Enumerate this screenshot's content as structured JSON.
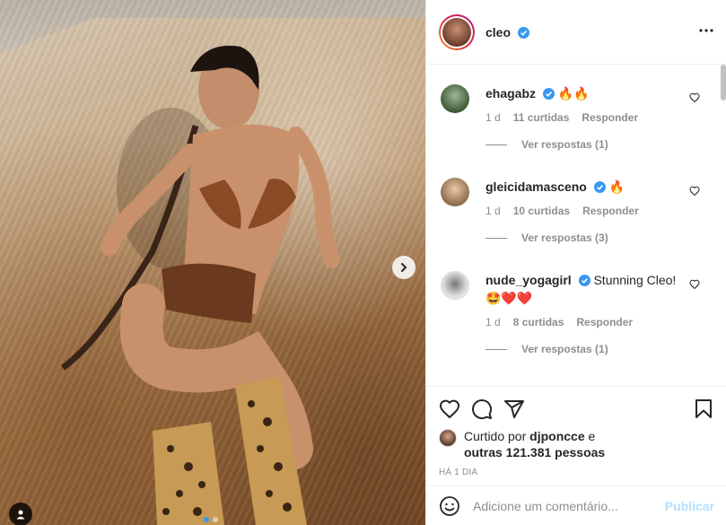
{
  "post": {
    "author": "cleo",
    "author_verified": true,
    "more_icon": "more-horizontal-icon"
  },
  "comments": [
    {
      "user": "ehagabz",
      "verified": true,
      "text": "🔥🔥",
      "age": "1 d",
      "likes": "11 curtidas",
      "reply_label": "Responder",
      "view_replies": "Ver respostas (1)"
    },
    {
      "user": "gleicidamasceno",
      "verified": true,
      "text": "🔥",
      "age": "1 d",
      "likes": "10 curtidas",
      "reply_label": "Responder",
      "view_replies": "Ver respostas (3)"
    },
    {
      "user": "nude_yogagirl",
      "verified": true,
      "text": "Stunning Cleo!",
      "text2": "🤩❤️❤️",
      "age": "1 d",
      "likes": "8 curtidas",
      "reply_label": "Responder",
      "view_replies": "Ver respostas (1)"
    }
  ],
  "likes": {
    "prefix": "Curtido por",
    "user": "djponcce",
    "connector": "e",
    "others": "outras 121.381 pessoas"
  },
  "timestamp": "HÁ 1 DIA",
  "comment_box": {
    "placeholder": "Adicione um comentário...",
    "publish_label": "Publicar"
  },
  "carousel": {
    "current_slide": 1,
    "total_slides": 2
  },
  "colors": {
    "verified_blue": "#3897f0",
    "text": "#262626",
    "muted": "#8e8e8e",
    "publish_disabled": "#b2dffc"
  }
}
